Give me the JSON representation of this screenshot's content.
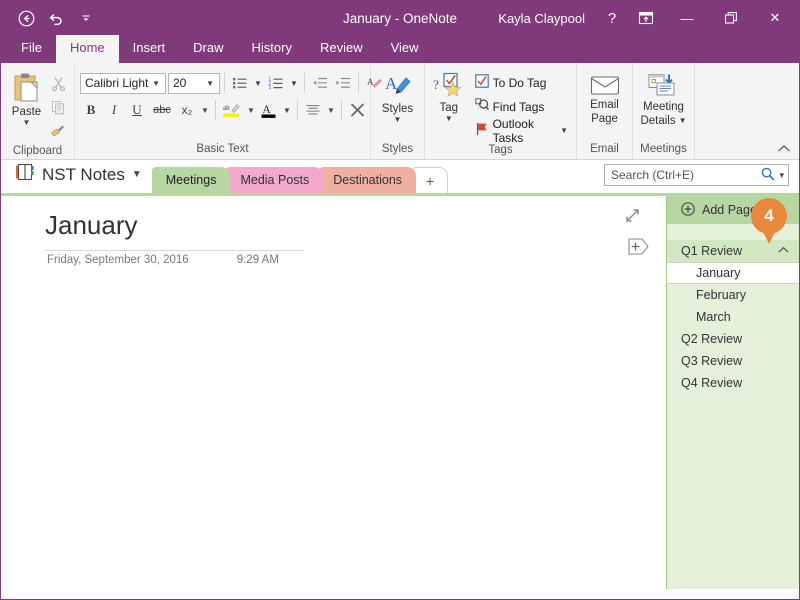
{
  "titlebar": {
    "back_icon": "back-circle-icon",
    "undo_icon": "undo-icon",
    "customize_icon": "customize-quick-access-icon",
    "title": "January - OneNote",
    "user": "Kayla Claypool",
    "help_label": "?",
    "ribbon_display_icon": "ribbon-display-options-icon",
    "minimize_label": "—",
    "restore_label": "❐",
    "close_label": "✕"
  },
  "ribbon_tabs": [
    {
      "label": "File",
      "active": false
    },
    {
      "label": "Home",
      "active": true
    },
    {
      "label": "Insert",
      "active": false
    },
    {
      "label": "Draw",
      "active": false
    },
    {
      "label": "History",
      "active": false
    },
    {
      "label": "Review",
      "active": false
    },
    {
      "label": "View",
      "active": false
    }
  ],
  "ribbon": {
    "clipboard": {
      "label": "Clipboard",
      "paste_label": "Paste",
      "paste_icon": "paste-icon",
      "cut_icon": "cut-icon",
      "copy_icon": "copy-icon",
      "format_painter_icon": "format-painter-icon"
    },
    "basic_text": {
      "label": "Basic Text",
      "font_name": "Calibri Light",
      "font_size": "20",
      "bullets_icon": "bullets-icon",
      "numbering_icon": "numbering-icon",
      "decrease_indent_icon": "decrease-indent-icon",
      "increase_indent_icon": "increase-indent-icon",
      "clear_formatting_icon": "clear-formatting-icon",
      "bold_label": "B",
      "italic_label": "I",
      "underline_label": "U",
      "strikethrough_label": "abc",
      "subscript_label": "x₂",
      "highlight_icon": "text-highlight-icon",
      "font_color_icon": "font-color-icon",
      "align_icon": "align-icon",
      "styles_clear_icon": "remove-formatting-x-icon"
    },
    "styles": {
      "label": "Styles",
      "button_label": "Styles",
      "icon": "styles-icon"
    },
    "tags": {
      "label": "Tags",
      "tag_button_label": "Tag",
      "tag_icon": "tag-icon",
      "todo_label": "To Do Tag",
      "todo_icon": "checkbox-icon",
      "find_label": "Find Tags",
      "find_icon": "find-tags-icon",
      "outlook_label": "Outlook Tasks",
      "outlook_icon": "flag-icon"
    },
    "email": {
      "label": "Email",
      "button_line1": "Email",
      "button_line2": "Page",
      "icon": "envelope-icon"
    },
    "meetings": {
      "label": "Meetings",
      "button_line1": "Meeting",
      "button_line2": "Details",
      "icon": "meeting-details-icon"
    },
    "collapse_icon": "collapse-ribbon-icon"
  },
  "navbar": {
    "notebook_icon": "notebook-icon",
    "notebook_name": "NST Notes",
    "notebook_caret": "▼",
    "sections": [
      {
        "label": "Meetings",
        "color": "#b6d7a1",
        "active": true
      },
      {
        "label": "Media Posts",
        "color": "#f3a8cd",
        "active": false
      },
      {
        "label": "Destinations",
        "color": "#f0b0a0",
        "active": false
      }
    ],
    "add_section_label": "+",
    "search": {
      "placeholder": "Search (Ctrl+E)",
      "value": "",
      "search_icon": "search-icon",
      "caret": "▾"
    }
  },
  "page": {
    "title": "January",
    "date": "Friday, September 30, 2016",
    "time": "9:29 AM",
    "expand_icon": "expand-page-icon",
    "add_space_icon": "insert-space-icon"
  },
  "pagelist": {
    "add_page_label": "Add Page",
    "add_page_icon": "add-page-plus-icon",
    "collapse_icon": "⌃",
    "badge": {
      "number": "4",
      "color": "#e8883a"
    },
    "pages": [
      {
        "label": "Q1 Review",
        "level": 1,
        "group": true,
        "selected": false,
        "collapsible": true
      },
      {
        "label": "January",
        "level": 2,
        "group": false,
        "selected": true,
        "collapsible": false
      },
      {
        "label": "February",
        "level": 2,
        "group": false,
        "selected": false,
        "collapsible": false
      },
      {
        "label": "March",
        "level": 2,
        "group": false,
        "selected": false,
        "collapsible": false
      },
      {
        "label": "Q2 Review",
        "level": 1,
        "group": false,
        "selected": false,
        "collapsible": false
      },
      {
        "label": "Q3 Review",
        "level": 1,
        "group": false,
        "selected": false,
        "collapsible": false
      },
      {
        "label": "Q4 Review",
        "level": 1,
        "group": false,
        "selected": false,
        "collapsible": false
      }
    ]
  },
  "colors": {
    "brand_purple": "#80397b",
    "section_green": "#b6d7a1",
    "pagelist_bg": "#e4f0da",
    "badge_orange": "#e8883a"
  }
}
